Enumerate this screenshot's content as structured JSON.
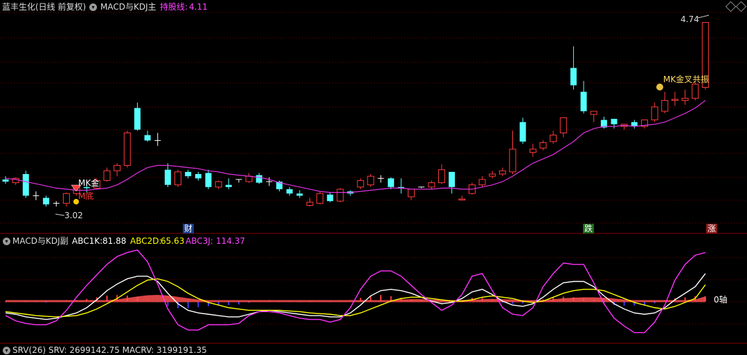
{
  "main_header": {
    "stock": "蓝丰生化(日线 前复权)",
    "indicator": "MACD与KDJ主",
    "hold_label": "持股线:",
    "hold_value": "4.11"
  },
  "sub_header": {
    "indicator": "MACD与KDJ副",
    "abc1k_label": "ABC1K:",
    "abc1k_value": "81.88",
    "abc2d_label": "ABC2D:",
    "abc2d_value": "65.63",
    "abc3j_label": "ABC3J:",
    "abc3j_value": "114.37"
  },
  "bottom_header": {
    "text": "SRV(26) SRV: 2699142.75 MACRV: 3199191.35"
  },
  "annotations": {
    "high_label": "4.74",
    "low_label": "3.02",
    "mk_gold": "MK金",
    "m_bottom": "M底",
    "mk_resonance": "MK金叉共振",
    "cai": "财",
    "die": "跌",
    "zhang": "涨",
    "zero_axis": "0轴"
  },
  "colors": {
    "up": "#ff3b3b",
    "down": "#54ffff",
    "ma": "#e033e0",
    "grid": "#7a0000",
    "white_line": "#ffffff",
    "yellow_line": "#ffff00",
    "magenta_line": "#ff33ff",
    "hist_pos": "#ff3b3b",
    "hist_neg": "#3b3bff",
    "macd_band_up": "#ff5050",
    "macd_band_down": "#40ff40"
  },
  "chart_data": [
    {
      "type": "candlestick",
      "title": "MACD与KDJ主",
      "ylim": [
        2.95,
        4.8
      ],
      "candles": [
        [
          3.27,
          3.3,
          3.23,
          3.25
        ],
        [
          3.24,
          3.29,
          3.22,
          3.28
        ],
        [
          3.32,
          3.35,
          3.1,
          3.12
        ],
        [
          3.12,
          3.16,
          3.08,
          3.12
        ],
        [
          3.1,
          3.12,
          3.02,
          3.04
        ],
        [
          3.05,
          3.07,
          3.02,
          3.05
        ],
        [
          3.05,
          3.15,
          3.02,
          3.14
        ],
        [
          3.14,
          3.22,
          3.12,
          3.2
        ],
        [
          3.2,
          3.25,
          3.15,
          3.19
        ],
        [
          3.19,
          3.28,
          3.18,
          3.26
        ],
        [
          3.26,
          3.38,
          3.25,
          3.35
        ],
        [
          3.35,
          3.42,
          3.3,
          3.4
        ],
        [
          3.4,
          3.72,
          3.38,
          3.7
        ],
        [
          3.93,
          3.98,
          3.72,
          3.73
        ],
        [
          3.68,
          3.72,
          3.62,
          3.63
        ],
        [
          3.63,
          3.7,
          3.58,
          3.63
        ],
        [
          3.36,
          3.42,
          3.2,
          3.22
        ],
        [
          3.22,
          3.36,
          3.2,
          3.34
        ],
        [
          3.34,
          3.36,
          3.28,
          3.3
        ],
        [
          3.32,
          3.34,
          3.26,
          3.28
        ],
        [
          3.33,
          3.36,
          3.18,
          3.2
        ],
        [
          3.2,
          3.26,
          3.18,
          3.25
        ],
        [
          3.22,
          3.28,
          3.18,
          3.2
        ],
        [
          3.27,
          3.27,
          3.24,
          3.27
        ],
        [
          3.25,
          3.33,
          3.24,
          3.3
        ],
        [
          3.31,
          3.33,
          3.23,
          3.24
        ],
        [
          3.25,
          3.29,
          3.21,
          3.25
        ],
        [
          3.25,
          3.26,
          3.16,
          3.18
        ],
        [
          3.18,
          3.2,
          3.12,
          3.14
        ],
        [
          3.14,
          3.17,
          3.1,
          3.12
        ],
        [
          3.03,
          3.1,
          3.02,
          3.06
        ],
        [
          3.05,
          3.16,
          3.04,
          3.14
        ],
        [
          3.13,
          3.15,
          3.06,
          3.07
        ],
        [
          3.07,
          3.19,
          3.06,
          3.18
        ],
        [
          3.16,
          3.17,
          3.12,
          3.14
        ],
        [
          3.2,
          3.28,
          3.18,
          3.26
        ],
        [
          3.22,
          3.32,
          3.2,
          3.3
        ],
        [
          3.28,
          3.31,
          3.24,
          3.28
        ],
        [
          3.28,
          3.29,
          3.18,
          3.2
        ],
        [
          3.2,
          3.28,
          3.14,
          3.19
        ],
        [
          3.11,
          3.18,
          3.08,
          3.18
        ],
        [
          3.2,
          3.2,
          3.19,
          3.2
        ],
        [
          3.2,
          3.26,
          3.18,
          3.24
        ],
        [
          3.24,
          3.41,
          3.23,
          3.36
        ],
        [
          3.34,
          3.34,
          3.14,
          3.2
        ],
        [
          3.08,
          3.12,
          3.08,
          3.09
        ],
        [
          3.14,
          3.24,
          3.13,
          3.22
        ],
        [
          3.22,
          3.3,
          3.2,
          3.27
        ],
        [
          3.3,
          3.35,
          3.28,
          3.32
        ],
        [
          3.32,
          3.38,
          3.3,
          3.35
        ],
        [
          3.34,
          3.72,
          3.32,
          3.55
        ],
        [
          3.8,
          3.84,
          3.6,
          3.62
        ],
        [
          3.52,
          3.6,
          3.48,
          3.55
        ],
        [
          3.56,
          3.63,
          3.54,
          3.61
        ],
        [
          3.62,
          3.72,
          3.6,
          3.68
        ],
        [
          3.7,
          3.78,
          3.66,
          3.84
        ],
        [
          4.3,
          4.5,
          4.1,
          4.14
        ],
        [
          4.08,
          4.18,
          3.88,
          3.9
        ],
        [
          3.87,
          3.9,
          3.8,
          3.9
        ],
        [
          3.82,
          3.85,
          3.74,
          3.75
        ],
        [
          3.83,
          3.83,
          3.74,
          3.78
        ],
        [
          3.76,
          3.78,
          3.73,
          3.78
        ],
        [
          3.8,
          3.82,
          3.74,
          3.76
        ],
        [
          3.76,
          3.82,
          3.74,
          3.82
        ],
        [
          3.82,
          3.98,
          3.8,
          3.94
        ],
        [
          3.9,
          4.08,
          3.88,
          4.0
        ],
        [
          4.0,
          4.08,
          3.95,
          4.01
        ],
        [
          4.0,
          4.1,
          3.96,
          4.02
        ],
        [
          4.02,
          4.18,
          4.0,
          4.15
        ],
        [
          4.12,
          4.72,
          4.1,
          4.72
        ]
      ],
      "ma": [
        3.28,
        3.27,
        3.25,
        3.23,
        3.21,
        3.19,
        3.18,
        3.17,
        3.17,
        3.18,
        3.19,
        3.22,
        3.27,
        3.33,
        3.38,
        3.4,
        3.4,
        3.39,
        3.38,
        3.37,
        3.35,
        3.34,
        3.32,
        3.31,
        3.3,
        3.29,
        3.27,
        3.24,
        3.22,
        3.2,
        3.18,
        3.16,
        3.15,
        3.15,
        3.15,
        3.16,
        3.17,
        3.18,
        3.19,
        3.19,
        3.18,
        3.18,
        3.18,
        3.19,
        3.19,
        3.18,
        3.18,
        3.2,
        3.22,
        3.25,
        3.3,
        3.36,
        3.42,
        3.46,
        3.5,
        3.56,
        3.62,
        3.7,
        3.74,
        3.76,
        3.76,
        3.77,
        3.76,
        3.77,
        3.78,
        3.8,
        3.84,
        3.88,
        3.93,
        4.0
      ]
    },
    {
      "type": "line",
      "title": "MACD与KDJ副",
      "ylim": [
        -20,
        120
      ],
      "series": [
        {
          "name": "ABC1K",
          "values": [
            22,
            20,
            16,
            14,
            12,
            14,
            18,
            22,
            30,
            42,
            56,
            66,
            74,
            78,
            78,
            70,
            52,
            36,
            26,
            22,
            20,
            18,
            16,
            16,
            20,
            24,
            26,
            24,
            22,
            20,
            18,
            18,
            16,
            16,
            22,
            34,
            48,
            56,
            58,
            56,
            52,
            46,
            40,
            36,
            38,
            44,
            54,
            58,
            50,
            40,
            34,
            32,
            36,
            46,
            58,
            68,
            70,
            70,
            62,
            48,
            36,
            28,
            22,
            20,
            22,
            30,
            42,
            52,
            62,
            82
          ]
        },
        {
          "name": "ABC2D",
          "values": [
            24,
            22,
            20,
            18,
            17,
            16,
            17,
            18,
            22,
            28,
            36,
            44,
            54,
            64,
            72,
            74,
            70,
            62,
            52,
            44,
            38,
            34,
            30,
            28,
            26,
            26,
            26,
            26,
            25,
            24,
            22,
            21,
            20,
            18,
            18,
            22,
            28,
            34,
            40,
            44,
            46,
            46,
            44,
            42,
            40,
            40,
            42,
            46,
            48,
            46,
            44,
            40,
            38,
            40,
            46,
            52,
            56,
            58,
            58,
            56,
            50,
            44,
            38,
            34,
            30,
            28,
            32,
            38,
            44,
            65
          ]
        },
        {
          "name": "ABC3J",
          "values": [
            18,
            10,
            6,
            4,
            4,
            10,
            26,
            46,
            64,
            80,
            96,
            108,
            114,
            118,
            100,
            66,
            28,
            4,
            -4,
            -4,
            4,
            4,
            4,
            6,
            18,
            24,
            24,
            22,
            18,
            14,
            12,
            12,
            8,
            12,
            30,
            58,
            78,
            86,
            86,
            78,
            64,
            50,
            38,
            26,
            34,
            50,
            78,
            82,
            56,
            30,
            20,
            18,
            30,
            62,
            82,
            98,
            96,
            96,
            68,
            36,
            14,
            2,
            -8,
            -8,
            8,
            34,
            72,
            96,
            110,
            114
          ]
        }
      ]
    }
  ]
}
